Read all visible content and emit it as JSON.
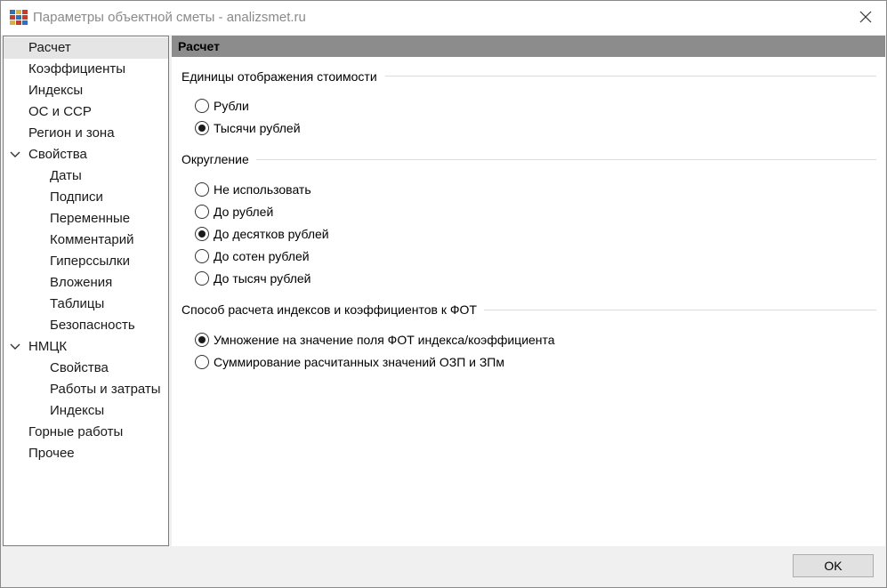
{
  "window": {
    "title": "Параметры объектной сметы - analizsmet.ru",
    "app_icon": "app-grid-icon",
    "close_icon": "close-icon"
  },
  "sidebar": {
    "items": [
      {
        "label": "Расчет",
        "level": 0,
        "selected": true
      },
      {
        "label": "Коэффициенты",
        "level": 0
      },
      {
        "label": "Индексы",
        "level": 0
      },
      {
        "label": "ОС и ССР",
        "level": 0
      },
      {
        "label": "Регион и зона",
        "level": 0
      },
      {
        "label": "Свойства",
        "level": 0,
        "expanded": true
      },
      {
        "label": "Даты",
        "level": 1
      },
      {
        "label": "Подписи",
        "level": 1
      },
      {
        "label": "Переменные",
        "level": 1
      },
      {
        "label": "Комментарий",
        "level": 1
      },
      {
        "label": "Гиперссылки",
        "level": 1
      },
      {
        "label": "Вложения",
        "level": 1
      },
      {
        "label": "Таблицы",
        "level": 1
      },
      {
        "label": "Безопасность",
        "level": 1
      },
      {
        "label": "НМЦК",
        "level": 0,
        "expanded": true
      },
      {
        "label": "Свойства",
        "level": 1
      },
      {
        "label": "Работы и затраты",
        "level": 1
      },
      {
        "label": "Индексы",
        "level": 1
      },
      {
        "label": "Горные работы",
        "level": 0
      },
      {
        "label": "Прочее",
        "level": 0
      }
    ]
  },
  "content": {
    "header": "Расчет",
    "groups": [
      {
        "title": "Единицы отображения стоимости",
        "options": [
          {
            "label": "Рубли",
            "checked": false
          },
          {
            "label": "Тысячи рублей",
            "checked": true
          }
        ]
      },
      {
        "title": "Округление",
        "options": [
          {
            "label": "Не использовать",
            "checked": false
          },
          {
            "label": "До рублей",
            "checked": false
          },
          {
            "label": "До десятков рублей",
            "checked": true
          },
          {
            "label": "До сотен рублей",
            "checked": false
          },
          {
            "label": "До тысяч рублей",
            "checked": false
          }
        ]
      },
      {
        "title": "Способ расчета индексов и коэффициентов к ФОТ",
        "options": [
          {
            "label": "Умножение на значение поля ФОТ индекса/коэффициента",
            "checked": true
          },
          {
            "label": "Суммирование расчитанных значений ОЗП и ЗПм",
            "checked": false
          }
        ]
      }
    ]
  },
  "footer": {
    "ok_label": "OK"
  }
}
